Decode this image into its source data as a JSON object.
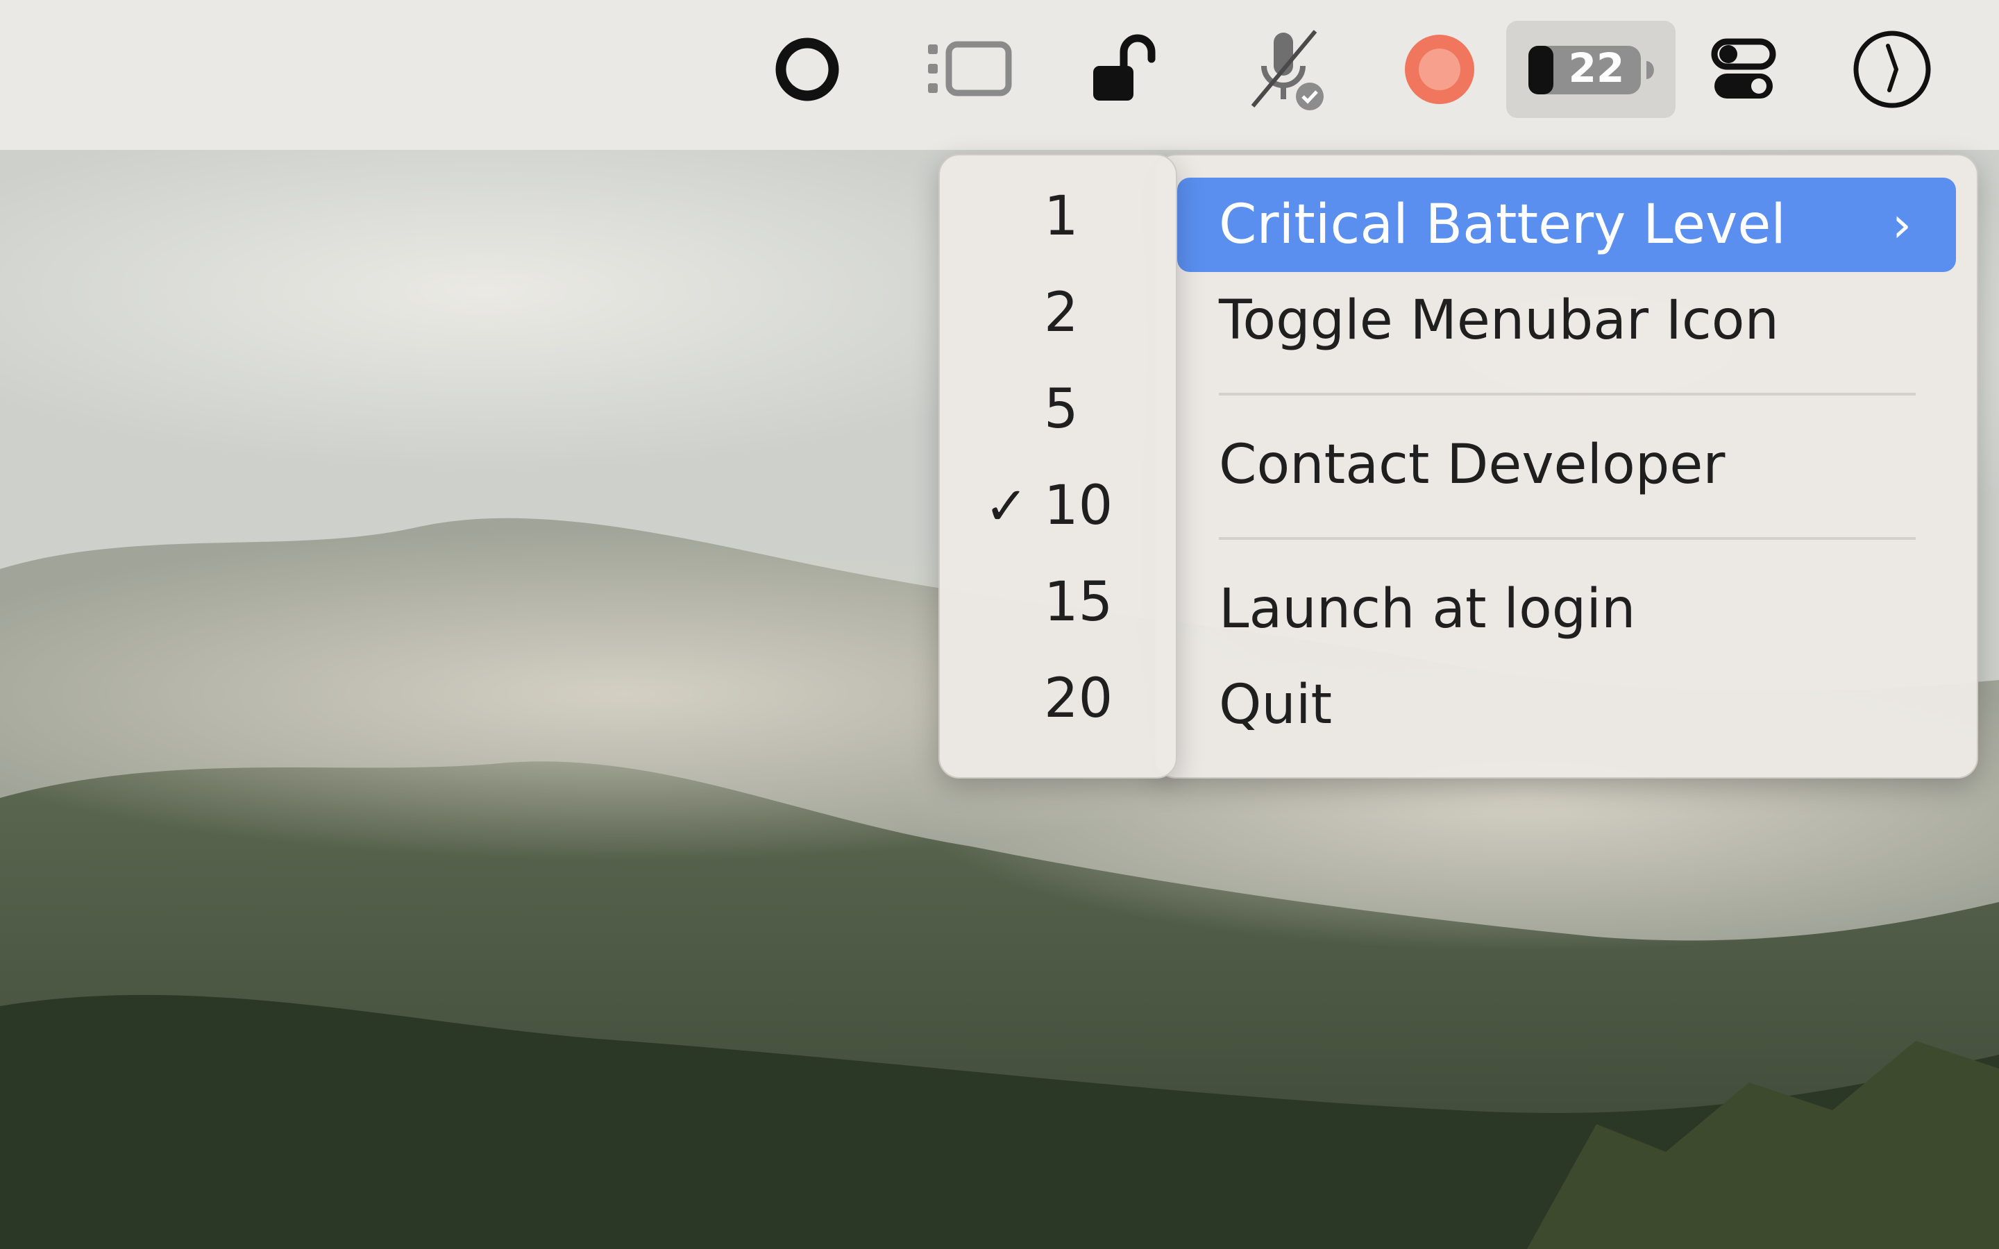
{
  "menubar": {
    "icons": [
      {
        "name": "ring-icon"
      },
      {
        "name": "sidebar-icon"
      },
      {
        "name": "unlock-icon"
      },
      {
        "name": "mic-off-icon"
      },
      {
        "name": "record-icon"
      },
      {
        "name": "battery-icon",
        "value": "22",
        "active": true
      },
      {
        "name": "toggles-icon"
      },
      {
        "name": "clock-icon"
      }
    ]
  },
  "colors": {
    "highlight": "#5a8ff0",
    "record": "#f0765e"
  },
  "submenu": {
    "items": [
      {
        "label": "1",
        "checked": false
      },
      {
        "label": "2",
        "checked": false
      },
      {
        "label": "5",
        "checked": false
      },
      {
        "label": "10",
        "checked": true
      },
      {
        "label": "15",
        "checked": false
      },
      {
        "label": "20",
        "checked": false
      }
    ],
    "check_glyph": "✓"
  },
  "menu": {
    "critical_battery_level": "Critical Battery Level",
    "chevron": "›",
    "toggle_menubar_icon": "Toggle Menubar Icon",
    "contact_developer": "Contact Developer",
    "launch_at_login": "Launch at login",
    "quit": "Quit"
  }
}
